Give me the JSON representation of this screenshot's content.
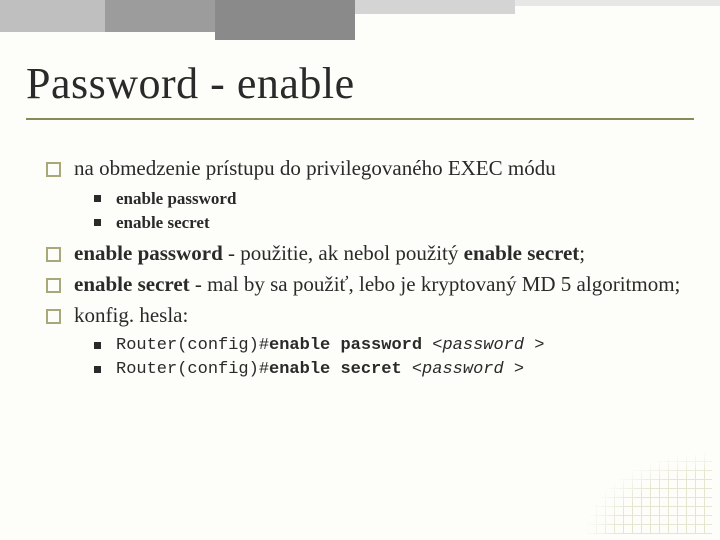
{
  "title": "Password - enable",
  "bullets": {
    "b1": "na obmedzenie prístupu do privilegovaného EXEC módu",
    "b1_sub": [
      "enable password",
      "enable secret"
    ],
    "b2_parts": {
      "strong1": "enable password",
      "mid1": " - použitie, ak nebol použitý ",
      "strong2": "enable secret",
      "tail": ";"
    },
    "b3_parts": {
      "strong1": "enable secret",
      "rest": " - mal by sa použiť, lebo je kryptovaný MD 5 algoritmom;"
    },
    "b4": "konfig. hesla:",
    "code": {
      "c1_prompt": "Router(config)#",
      "c1_cmd": "enable password ",
      "c1_param": "<password >",
      "c2_prompt": "Router(config)#",
      "c2_cmd": "enable secret ",
      "c2_param": "<password >"
    }
  }
}
